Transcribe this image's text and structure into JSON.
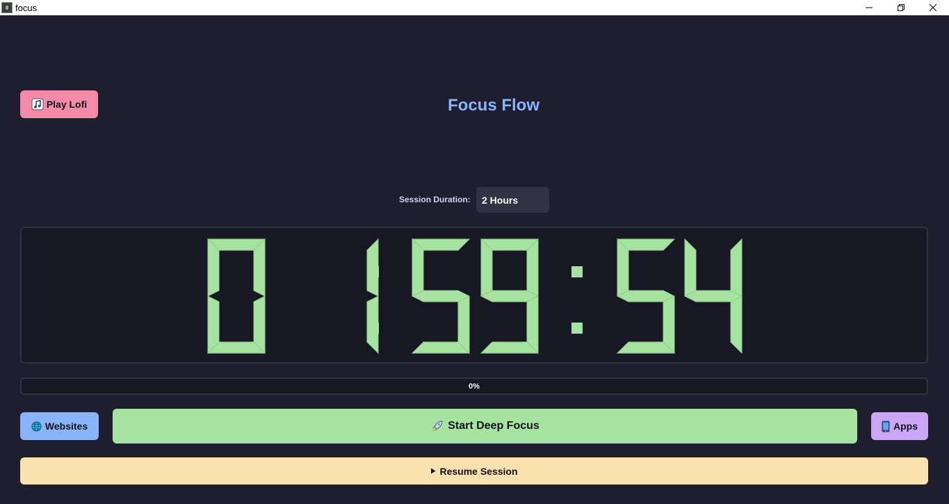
{
  "window": {
    "title": "focus"
  },
  "header": {
    "title": "Focus Flow",
    "lofi_button": "Play Lofi"
  },
  "session": {
    "duration_label": "Session Duration:",
    "duration_value": "2 Hours"
  },
  "timer": {
    "display": "01:59:54",
    "digits": [
      "0",
      "1",
      "5",
      "9",
      "5",
      "4"
    ]
  },
  "progress": {
    "value": 0,
    "label": "0%"
  },
  "actions": {
    "websites_label": "Websites",
    "start_label": "Start Deep Focus",
    "apps_label": "Apps",
    "resume_label": "Resume Session"
  },
  "colors": {
    "background": "#1e1e2e",
    "panel": "#181825",
    "accent_blue": "#89b4fa",
    "lofi_pink": "#f38ba8",
    "start_green": "#a6e3a1",
    "apps_purple": "#cba6f7",
    "resume_yellow": "#f9e2af",
    "segment_on": "#a6e3a1"
  },
  "icons": {
    "lofi": "music-note-icon",
    "websites": "globe-icon",
    "start": "rocket-icon",
    "apps": "phone-icon",
    "resume": "play-triangle-icon"
  }
}
